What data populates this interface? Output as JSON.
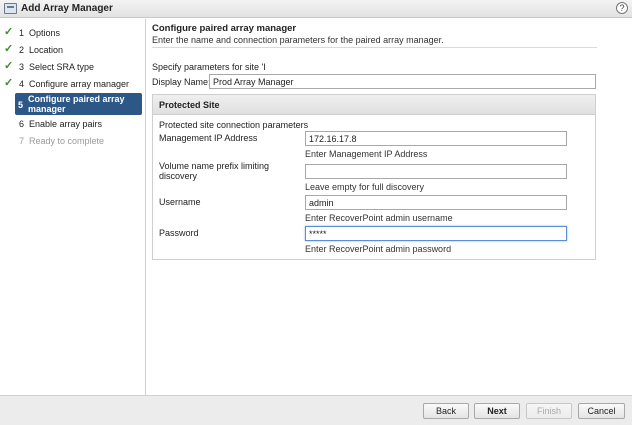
{
  "window": {
    "title": "Add Array Manager",
    "help_icon": "help-icon",
    "help_glyph": "?"
  },
  "sidebar": {
    "items": [
      {
        "number": "1",
        "label": "Options",
        "state": "done"
      },
      {
        "number": "2",
        "label": "Location",
        "state": "done"
      },
      {
        "number": "3",
        "label": "Select SRA type",
        "state": "done"
      },
      {
        "number": "4",
        "label": "Configure array manager",
        "state": "done"
      },
      {
        "number": "5",
        "label": "Configure paired array manager",
        "state": "active"
      },
      {
        "number": "6",
        "label": "Enable array pairs",
        "state": "pending"
      },
      {
        "number": "7",
        "label": "Ready to complete",
        "state": "disabled"
      }
    ]
  },
  "main": {
    "title": "Configure paired array manager",
    "subtitle": "Enter the name and connection parameters for the paired array manager.",
    "specify_text": "Specify parameters for site 'I",
    "display_name": {
      "label": "Display Name:",
      "value": "Prod Array Manager"
    },
    "panel": {
      "title": "Protected Site",
      "intro": "Protected site connection parameters",
      "fields": {
        "mgmt_ip": {
          "label": "Management IP Address",
          "value": "172.16.17.8",
          "hint": "Enter Management IP Address"
        },
        "prefix": {
          "label": "Volume name prefix limiting discovery",
          "value": "",
          "hint": "Leave empty for full discovery"
        },
        "username": {
          "label": "Username",
          "value": "admin",
          "hint": "Enter RecoverPoint admin username"
        },
        "password": {
          "label": "Password",
          "value": "*****",
          "hint": "Enter RecoverPoint admin password"
        }
      }
    }
  },
  "footer": {
    "back": "Back",
    "next": "Next",
    "finish": "Finish",
    "cancel": "Cancel"
  },
  "colors": {
    "active_step": "#2d5786",
    "check": "#3a8f2a",
    "focus_border": "#5b8ed4"
  }
}
